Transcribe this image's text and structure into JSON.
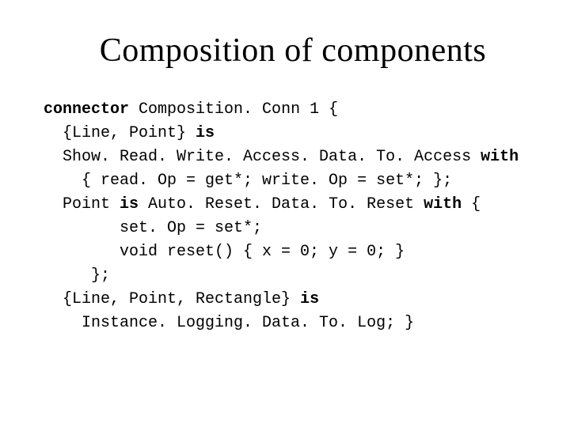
{
  "title": "Composition of components",
  "code": {
    "kw_connector": "connector",
    "l1_name": " Composition. Conn 1 {",
    "l2_pre": "  {Line, Point} ",
    "kw_is1": "is",
    "l3_pre": "  Show. Read. Write. Access. Data. To. Access ",
    "kw_with1": "with",
    "l4": "    { read. Op = get*; write. Op = set*; };",
    "l5_pre": "  Point ",
    "kw_is2": "is",
    "l5_mid": " Auto. Reset. Data. To. Reset ",
    "kw_with2": "with",
    "l5_end": " {",
    "l6": "        set. Op = set*;",
    "l7": "        void reset() { x = 0; y = 0; }",
    "l8": "     };",
    "l9_pre": "  {Line, Point, Rectangle} ",
    "kw_is3": "is",
    "l10": "    Instance. Logging. Data. To. Log; }"
  }
}
